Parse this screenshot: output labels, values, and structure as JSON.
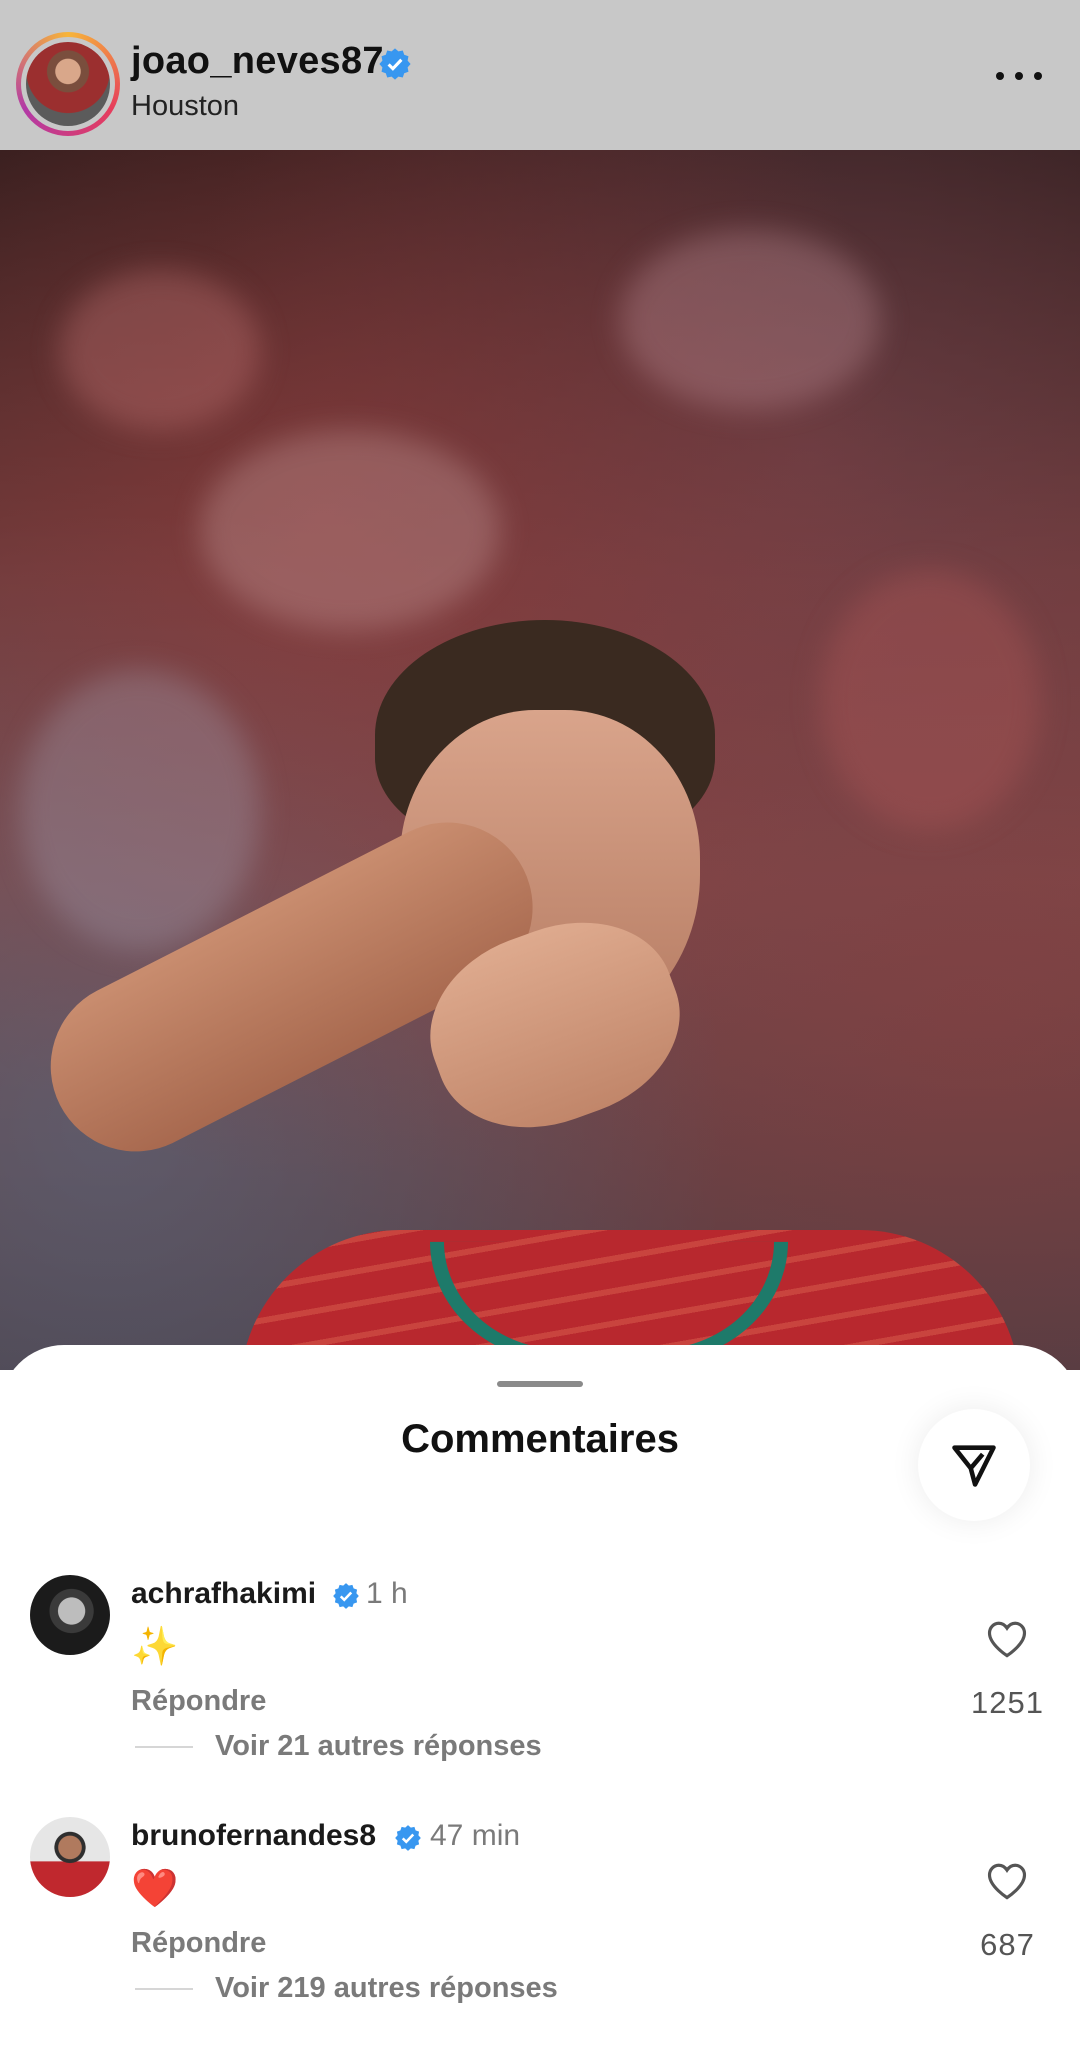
{
  "header": {
    "username": "joao_neves87",
    "location": "Houston",
    "verified_icon": "verified-badge-icon",
    "more_icon": "more-options-icon"
  },
  "post": {
    "image": "photo of player in red jersey blowing a kiss"
  },
  "comments_sheet": {
    "title": "Commentaires",
    "share_icon": "send-icon",
    "comments": [
      {
        "username": "achrafhakimi",
        "time": "1 h",
        "text": "✨",
        "reply_label": "Répondre",
        "more_replies": "Voir 21 autres réponses",
        "likes": "1251"
      },
      {
        "username": "brunofernandes8",
        "time": "47 min",
        "text": "❤️",
        "reply_label": "Répondre",
        "more_replies": "Voir 219 autres réponses",
        "likes": "687"
      }
    ]
  },
  "colors": {
    "verified": "#3897f0",
    "header_bg": "#c8c8c8",
    "muted_text": "#7a7a7a"
  }
}
